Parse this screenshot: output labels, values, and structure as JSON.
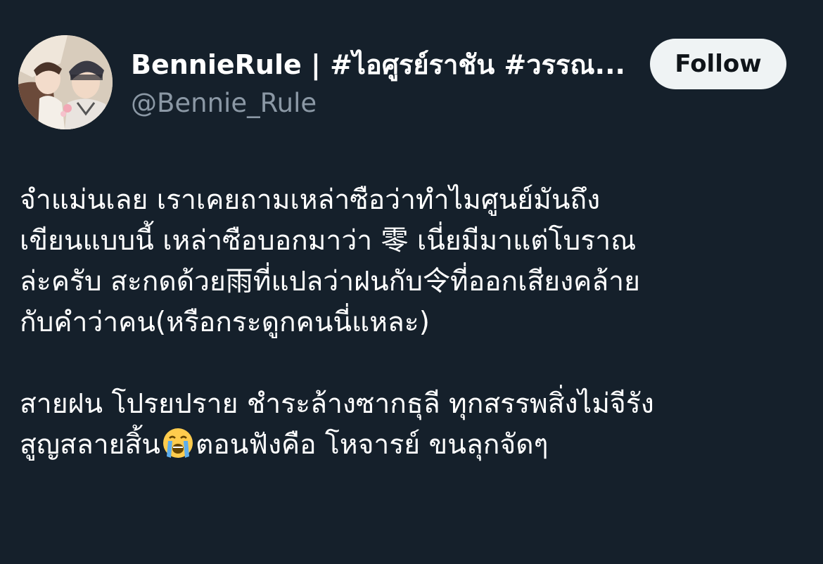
{
  "author": {
    "display_name": "BennieRule | #ไอศูรย์ราชัน #วรรณ...",
    "handle": "@Bennie_Rule",
    "avatar_icon": "anime-avatar"
  },
  "follow_label": "Follow",
  "tweet": {
    "paragraph1": [
      "จำแม่นเลย เราเคยถามเหล่าซือว่าทำไมศูนย์มันถึง",
      "เขียนแบบนี้ เหล่าซือบอกมาว่า 零 เนี่ยมีมาแต่โบราณ",
      "ล่ะครับ สะกดด้วย雨ที่แปลว่าฝนกับ令ที่ออกเสียงคล้าย",
      "กับคำว่าคน(หรือกระดูกคนนี่แหละ)"
    ],
    "paragraph2_line1": "สายฝน โปรยปราย ชำระล้างซากธุลี ทุกสรรพสิ่งไม่จีรัง",
    "paragraph2_line2_before": "สูญสลายสิ้น",
    "paragraph2_emoji": "loudly-crying-face-emoji",
    "paragraph2_line2_after": "ตอนฟังคือ โหจารย์ ขนลุกจัดๆ"
  },
  "colors": {
    "background": "#15202b",
    "text": "#ffffff",
    "secondary_text": "#8b98a5",
    "button_bg": "#eff3f4",
    "button_text": "#0f1419"
  }
}
